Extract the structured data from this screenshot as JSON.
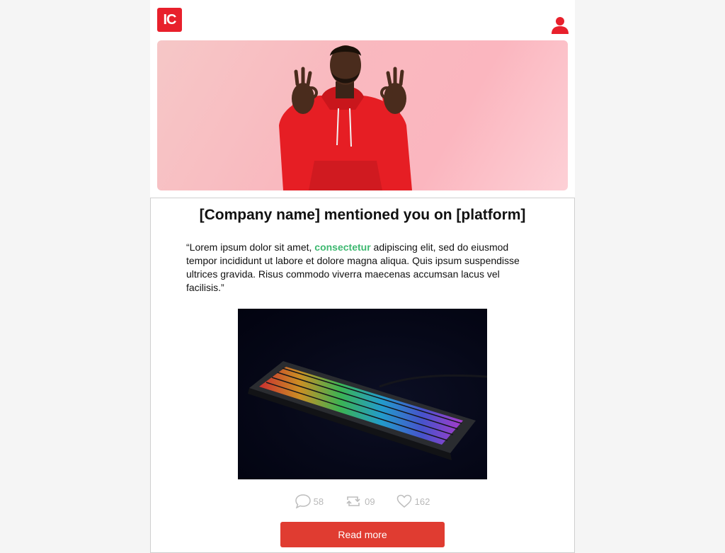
{
  "brand": {
    "logo_text": "IC",
    "accent": "#e8202c"
  },
  "header": {
    "user_icon": "user-icon"
  },
  "card": {
    "title": "[Company name] mentioned you on [platform]",
    "quote_before": "“Lorem ipsum dolor sit amet, ",
    "quote_highlight": "consectetur",
    "quote_after": " adipiscing elit, sed do eiusmod tempor incididunt ut labore et dolore magna aliqua. Quis ipsum suspendisse ultrices gravida. Risus commodo viverra maecenas accumsan lacus vel facilisis.”",
    "highlight_color": "#3db870"
  },
  "stats": {
    "comments": "58",
    "reposts": "09",
    "likes": "162"
  },
  "cta": {
    "label": "Read more",
    "color": "#e03c31"
  }
}
